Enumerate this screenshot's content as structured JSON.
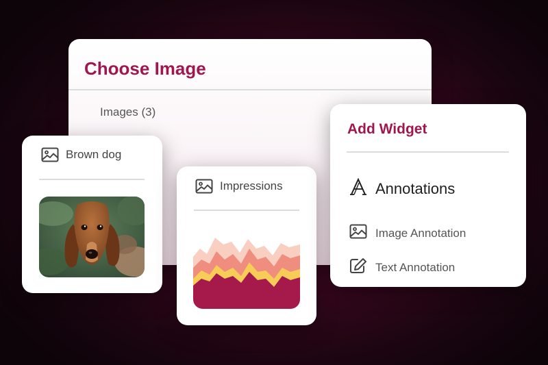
{
  "choose_image": {
    "title": "Choose Image",
    "images_count": "Images (3)"
  },
  "image_card": {
    "label": "Brown dog",
    "icon": "image-icon"
  },
  "impressions_card": {
    "label": "Impressions",
    "icon": "image-icon"
  },
  "add_widget": {
    "title": "Add Widget",
    "heading": "Annotations",
    "heading_icon": "font-icon",
    "options": [
      {
        "label": "Image Annotation",
        "icon": "image-icon"
      },
      {
        "label": "Text Annotation",
        "icon": "edit-icon"
      }
    ]
  },
  "colors": {
    "accent": "#a0164f",
    "chart_dark": "#a51a4b",
    "chart_yellow": "#f7cd57",
    "chart_coral": "#ef8d7f",
    "chart_peach": "#f9cfc2"
  }
}
